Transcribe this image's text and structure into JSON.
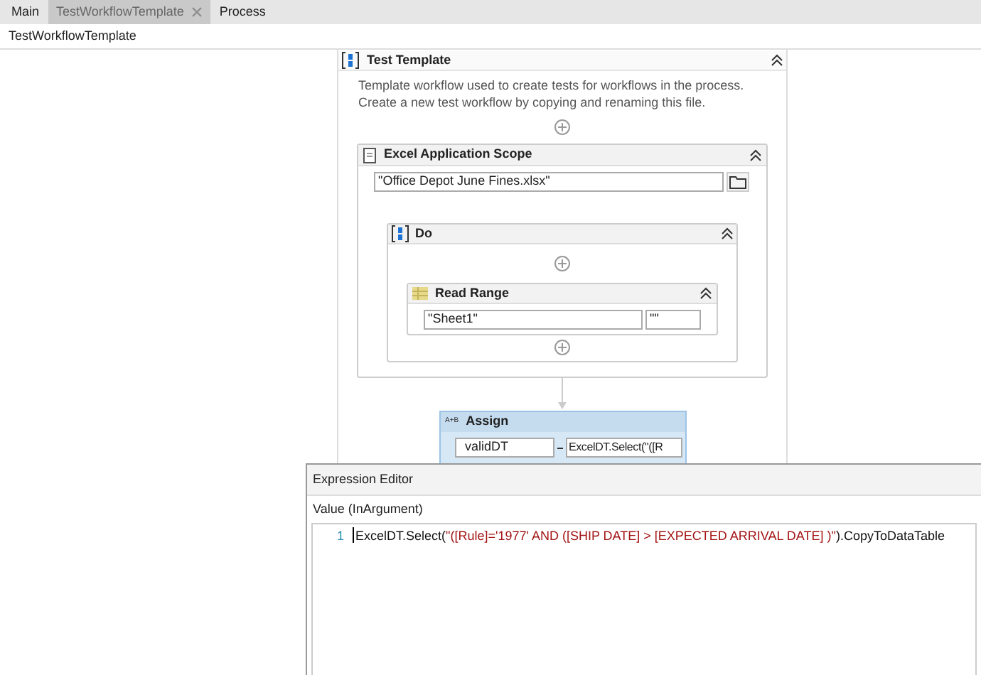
{
  "tabs": [
    {
      "label": "Main",
      "selected": false,
      "closable": false
    },
    {
      "label": "TestWorkflowTemplate",
      "selected": true,
      "closable": true
    },
    {
      "label": "Process",
      "selected": false,
      "closable": false
    }
  ],
  "breadcrumb": "TestWorkflowTemplate",
  "sequence": {
    "title": "Test Template",
    "description": "Template workflow used to create tests for workflows in the process.\nCreate a new test workflow by copying and renaming this file.",
    "scope": {
      "title": "Excel Application Scope",
      "path": "\"Office Depot June Fines.xlsx\"",
      "do": {
        "title": "Do",
        "read_range": {
          "title": "Read Range",
          "sheet": "\"Sheet1\"",
          "range": "\"\""
        }
      }
    }
  },
  "assign": {
    "icon_text": "A+B",
    "title": "Assign",
    "to": "validDT",
    "value": "ExcelDT.Select(\"([R"
  },
  "expression_editor": {
    "title": "Expression Editor",
    "label": "Value (InArgument)",
    "line_number": "1",
    "tokens": [
      {
        "kind": "plain",
        "text": "ExcelDT.Select("
      },
      {
        "kind": "string",
        "text": "\"([Rule]='1977' AND ([SHIP DATE] > [EXPECTED ARRIVAL DATE] )\""
      },
      {
        "kind": "plain",
        "text": ").CopyToDataTable"
      }
    ]
  }
}
